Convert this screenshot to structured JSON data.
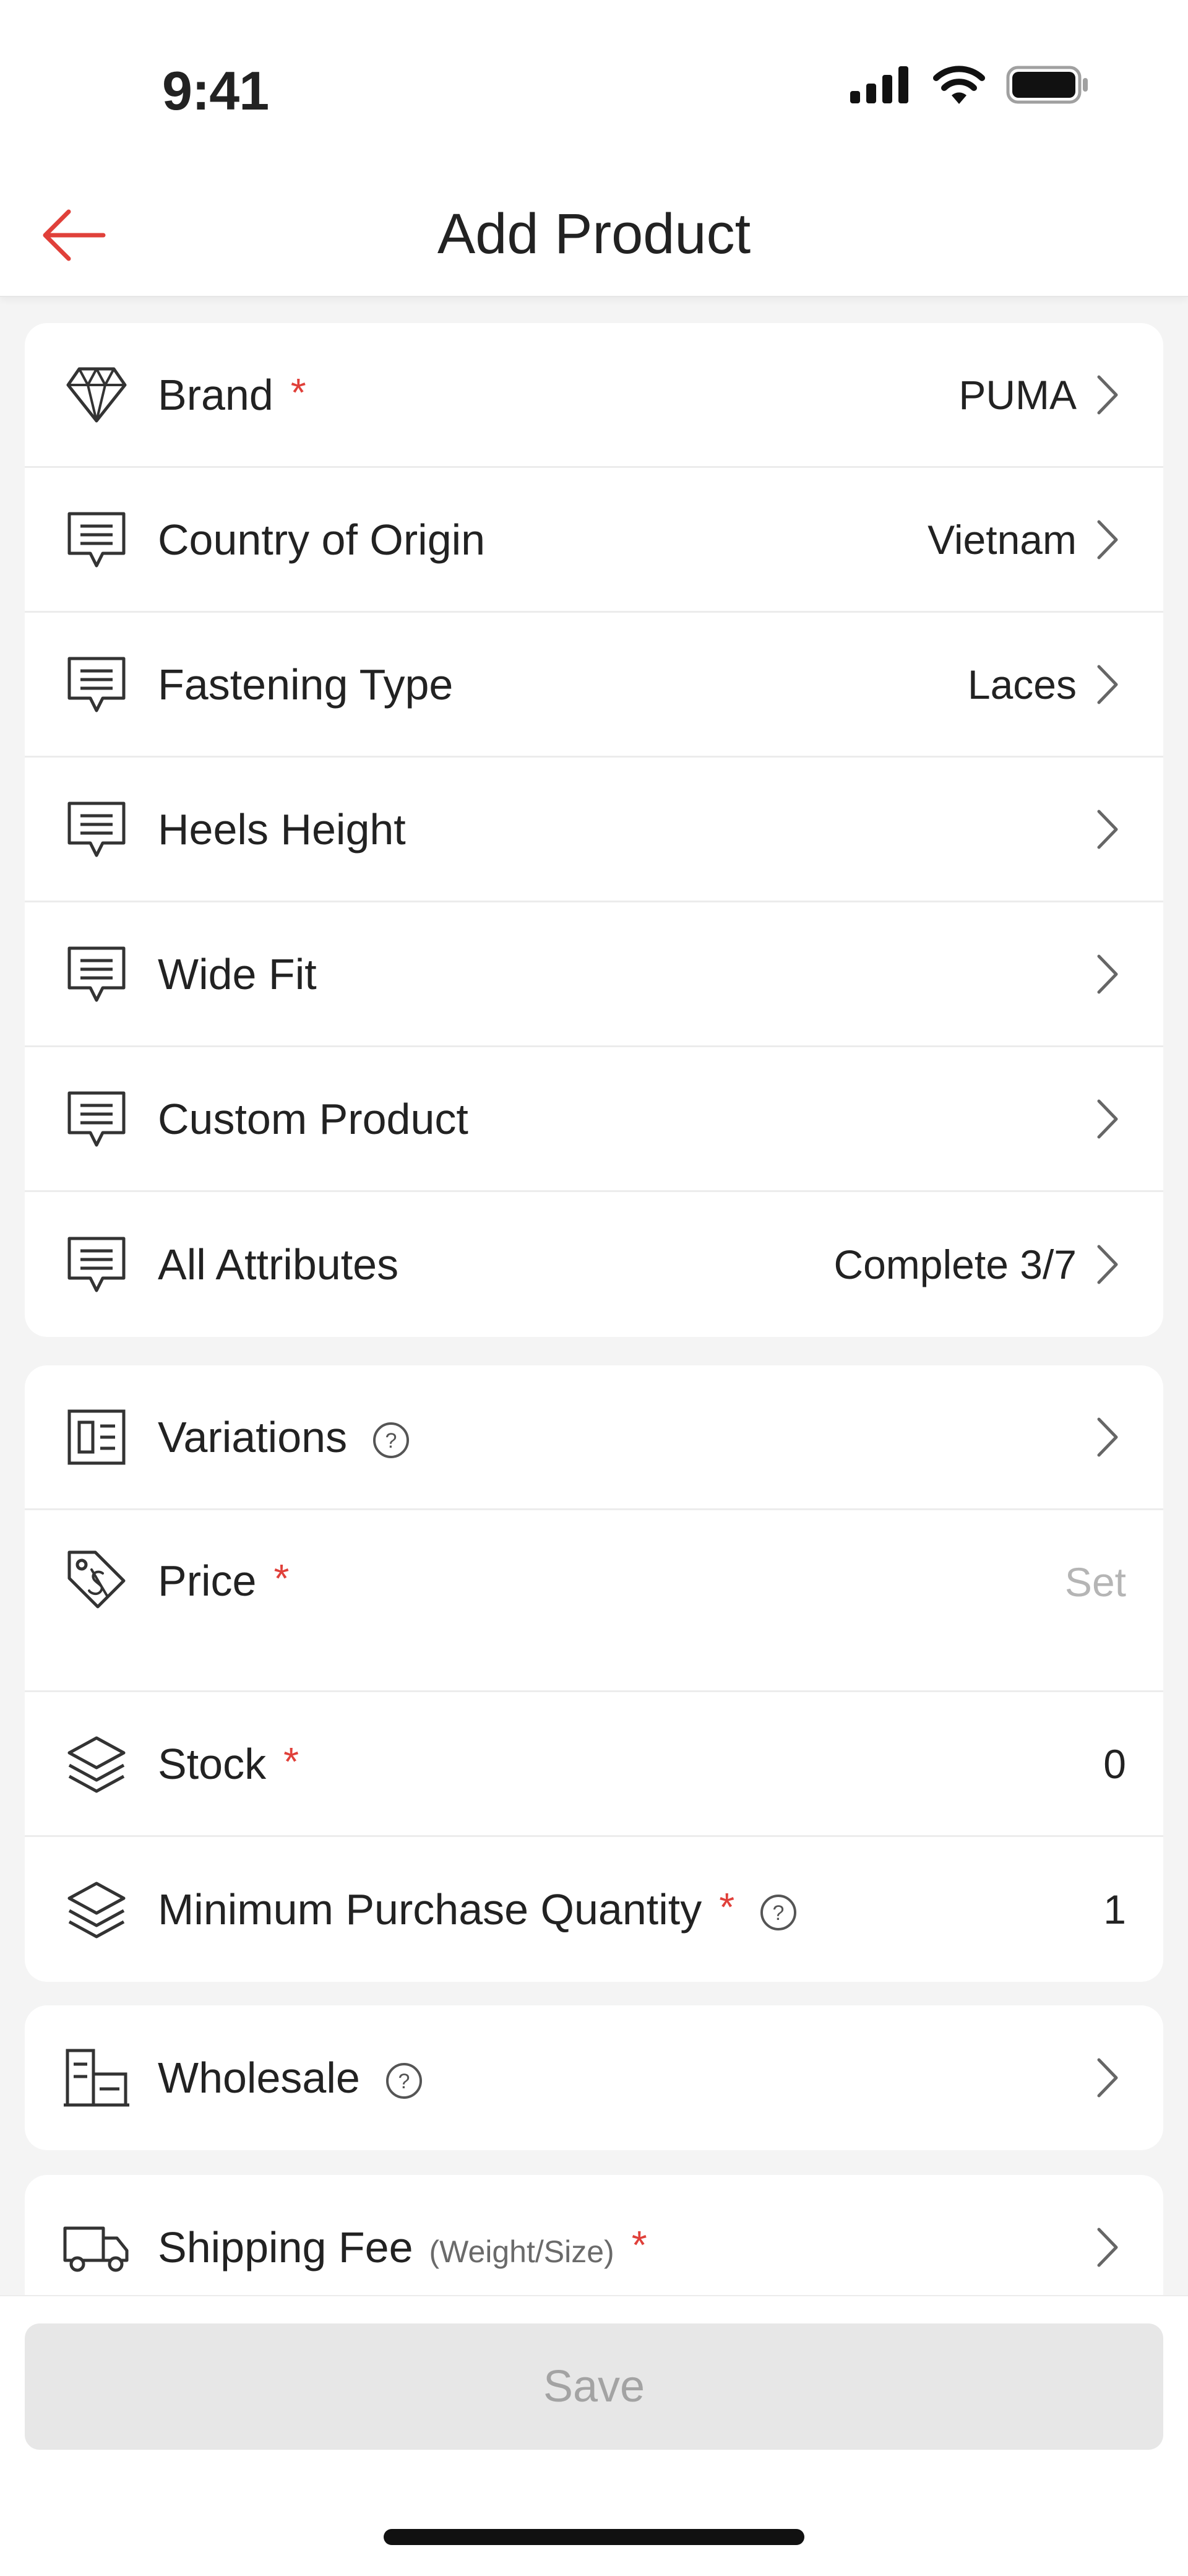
{
  "status_bar": {
    "time": "9:41"
  },
  "header": {
    "title": "Add Product",
    "back_icon": "arrow-left-icon"
  },
  "attributes_card": {
    "rows": [
      {
        "label": "Brand",
        "required": "*",
        "value": "PUMA",
        "icon": "diamond-icon"
      },
      {
        "label": "Country of Origin",
        "value": "Vietnam",
        "icon": "message-icon"
      },
      {
        "label": "Fastening Type",
        "value": "Laces",
        "icon": "message-icon"
      },
      {
        "label": "Heels Height",
        "value": "",
        "icon": "message-icon"
      },
      {
        "label": "Wide Fit",
        "value": "",
        "icon": "message-icon"
      },
      {
        "label": "Custom Product",
        "value": "",
        "icon": "message-icon"
      },
      {
        "label": "All Attributes",
        "value": "Complete 3/7",
        "icon": "message-icon"
      }
    ]
  },
  "pricing_card": {
    "variations": {
      "label": "Variations",
      "help": "?"
    },
    "price": {
      "label": "Price",
      "required": "*",
      "placeholder": "Set"
    },
    "stock": {
      "label": "Stock",
      "required": "*",
      "value": "0"
    },
    "min_qty": {
      "label": "Minimum Purchase Quantity",
      "required": "*",
      "help": "?",
      "value": "1"
    }
  },
  "wholesale_card": {
    "label": "Wholesale",
    "help": "?"
  },
  "shipping_card": {
    "label": "Shipping Fee",
    "sublabel": "(Weight/Size)",
    "required": "*"
  },
  "footer": {
    "save_label": "Save"
  },
  "colors": {
    "accent": "#e0403a",
    "disabled_bg": "#e7e7e7",
    "disabled_text": "#a3a3a3"
  }
}
